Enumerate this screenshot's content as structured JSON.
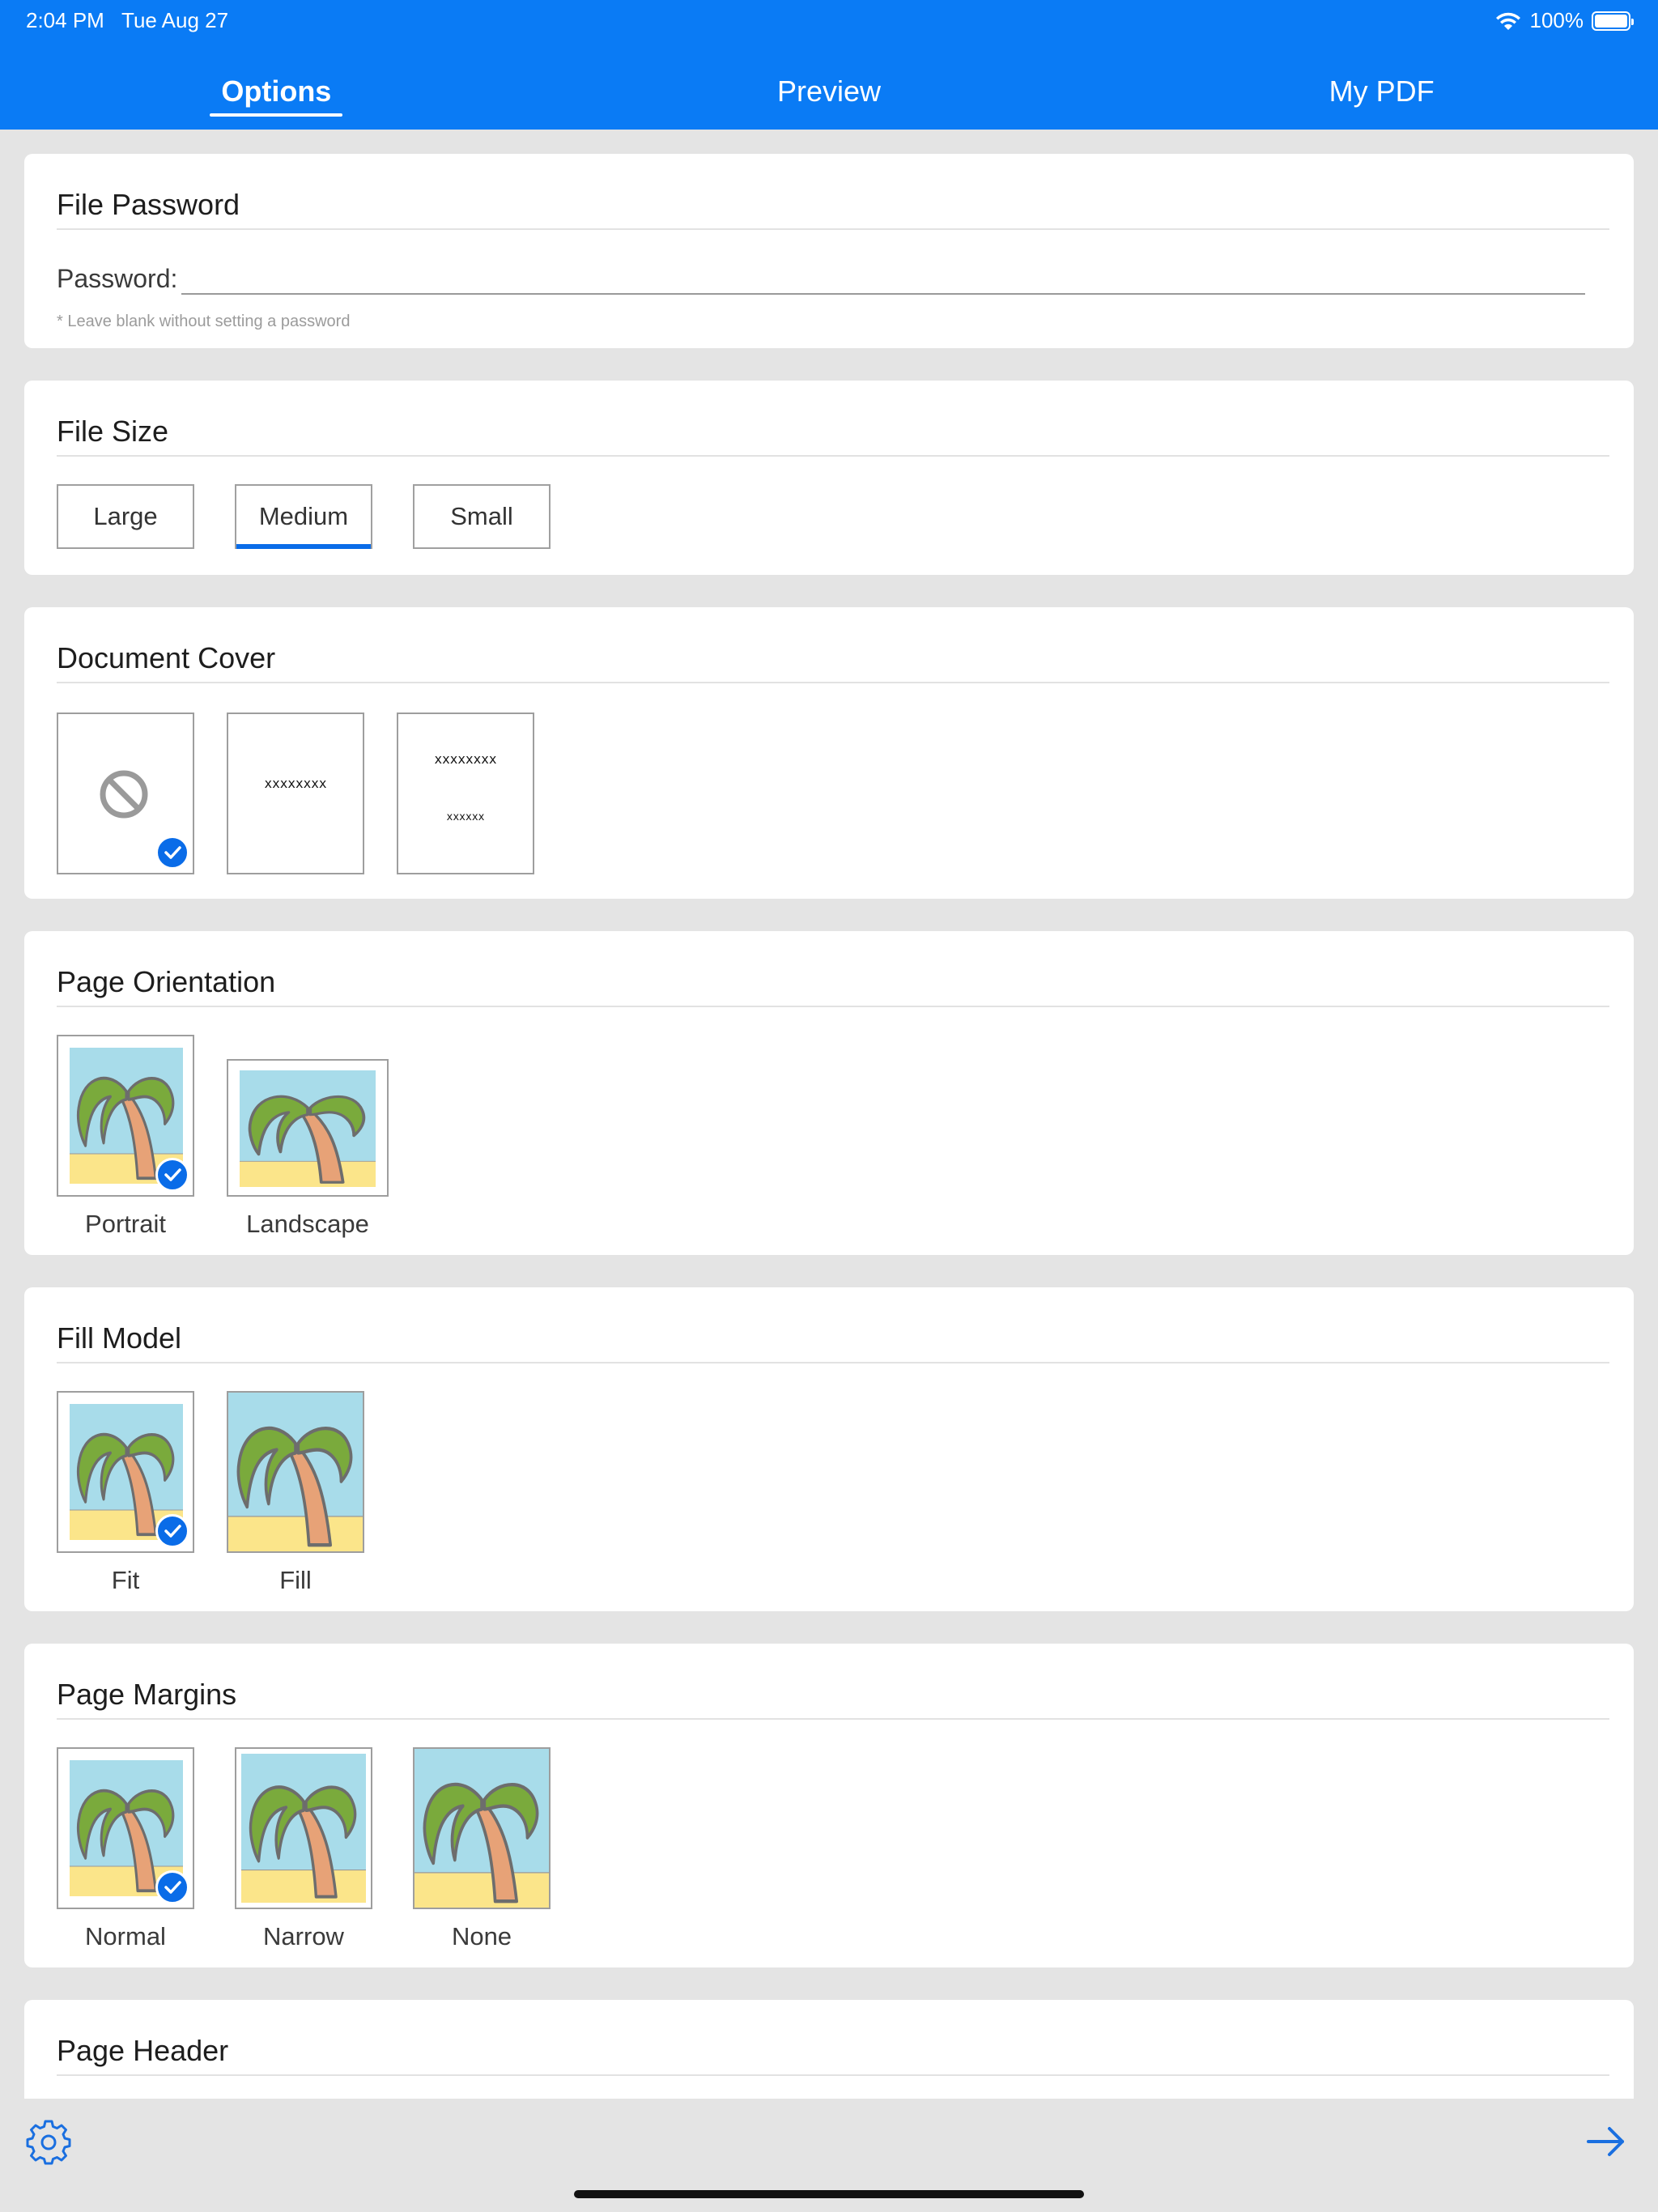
{
  "status_bar": {
    "time": "2:04 PM",
    "date": "Tue Aug 27",
    "battery": "100%"
  },
  "tabs": [
    {
      "label": "Options",
      "active": true
    },
    {
      "label": "Preview",
      "active": false
    },
    {
      "label": "My PDF",
      "active": false
    }
  ],
  "file_password": {
    "title": "File Password",
    "label": "Password:",
    "value": "",
    "note": "* Leave blank without setting a password"
  },
  "file_size": {
    "title": "File Size",
    "options": [
      "Large",
      "Medium",
      "Small"
    ],
    "selected": "Medium"
  },
  "document_cover": {
    "title": "Document Cover",
    "cover1_text": "xxxxxxxx",
    "cover2_title": "xxxxxxxx",
    "cover2_sub": "xxxxxx",
    "selected_index": 0
  },
  "page_orientation": {
    "title": "Page Orientation",
    "options": [
      "Portrait",
      "Landscape"
    ],
    "selected": "Portrait"
  },
  "fill_model": {
    "title": "Fill Model",
    "options": [
      "Fit",
      "Fill"
    ],
    "selected": "Fit"
  },
  "page_margins": {
    "title": "Page Margins",
    "options": [
      "Normal",
      "Narrow",
      "None"
    ],
    "selected": "Normal"
  },
  "page_header": {
    "title": "Page Header"
  },
  "colors": {
    "accent": "#0a7bf5",
    "check": "#0a6ce8",
    "background": "#e4e4e4"
  },
  "icons": {
    "settings": "gear-icon",
    "next": "arrow-right-icon"
  }
}
